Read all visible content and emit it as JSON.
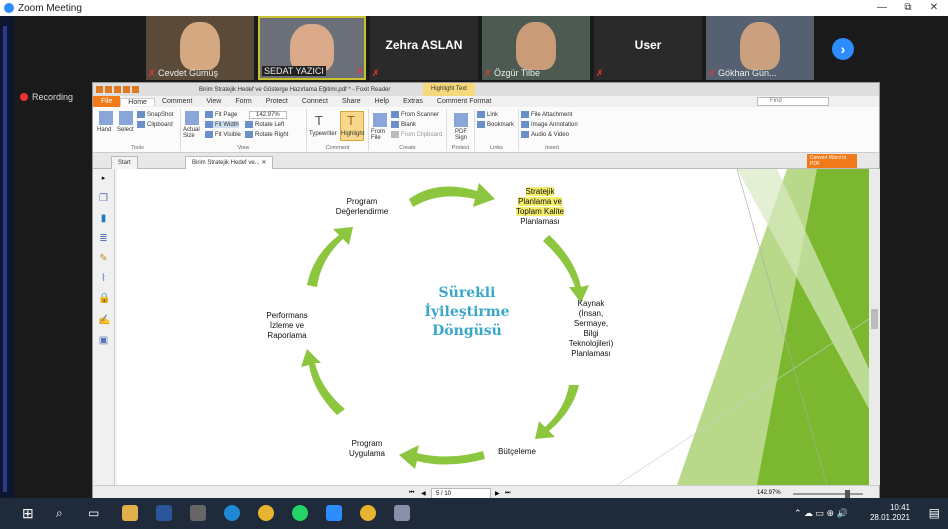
{
  "window": {
    "title": "Zoom Meeting",
    "minimize": "—",
    "restore": "⧉",
    "close": "✕"
  },
  "participants": [
    {
      "name": "Cevdet Gümüş",
      "type": "video"
    },
    {
      "name": "SEDAT YAZICI",
      "type": "video"
    },
    {
      "name": "Zehra ASLAN",
      "type": "name"
    },
    {
      "name": "Özgür Tilbe",
      "type": "video"
    },
    {
      "name": "User",
      "type": "name"
    },
    {
      "name": "Gökhan Gün...",
      "type": "video"
    }
  ],
  "next_icon": "›",
  "recording": "Recording",
  "reader": {
    "title": "Birim Stratejik Hedef ve Gösterge Hazırlama Eğitimi.pdf * - Foxit Reader",
    "highlight_tab": "Highlight Text",
    "menu": [
      "File",
      "Home",
      "Comment",
      "View",
      "Form",
      "Protect",
      "Connect",
      "Share",
      "Help",
      "Extras",
      "Comment Format"
    ],
    "find_placeholder": "Find",
    "ribbon": {
      "tools": {
        "hand": "Hand",
        "select": "Select",
        "snapshot": "SnapShot",
        "clipboard": "Clipboard",
        "label": "Tools"
      },
      "view": {
        "actual": "Actual Size",
        "fit_page": "Fit Page",
        "fit_width": "Fit Width",
        "fit_visible": "Fit Visible",
        "zoom": "142.97%",
        "rotate_left": "Rotate Left",
        "rotate_right": "Rotate Right",
        "label": "View"
      },
      "comment": {
        "typewriter": "Typewriter",
        "highlight": "Highlight",
        "label": "Comment"
      },
      "create": {
        "from_file": "From File",
        "from_scanner": "From Scanner",
        "blank": "Blank",
        "from_clipboard": "From Clipboard",
        "label": "Create"
      },
      "protect": {
        "pdf_sign": "PDF Sign",
        "label": "Protect"
      },
      "links": {
        "link": "Link",
        "bookmark": "Bookmark",
        "label": "Links"
      },
      "insert": {
        "file_attachment": "File Attachment",
        "image_annotation": "Image Annotation",
        "audio_video": "Audio & Video",
        "label": "Insert"
      }
    },
    "tabs": [
      "Start",
      "Birim Stratejik Hedef ve..."
    ],
    "convert": "Convert Word to PDF",
    "page": "5 / 10",
    "zoom_status": "142.97%"
  },
  "slide": {
    "title": "Sürekli İyileştirme Döngüsü",
    "title_lines": [
      "Sürekli",
      "İyileştirme",
      "Döngüsü"
    ],
    "stages": {
      "s1": [
        "Stratejik",
        "Planlama ve",
        "Toplam Kalite",
        "Planlaması"
      ],
      "s2": [
        "Kaynak",
        "(İnsan,",
        "Sermaye,",
        "Bilgi",
        "Teknolojileri)",
        "Planlaması"
      ],
      "s3": [
        "Bütçeleme"
      ],
      "s4": [
        "Program",
        "Uygulama"
      ],
      "s5": [
        "Performans",
        "İzleme ve",
        "Raporlama"
      ],
      "s6": [
        "Program",
        "Değerlendirme"
      ]
    },
    "colors": {
      "arrow": "#8cc63f",
      "title": "#3aa6c8",
      "bg_green": "#7cb82f"
    }
  },
  "taskbar": {
    "time": "10:41",
    "date": "28.01.2021"
  }
}
